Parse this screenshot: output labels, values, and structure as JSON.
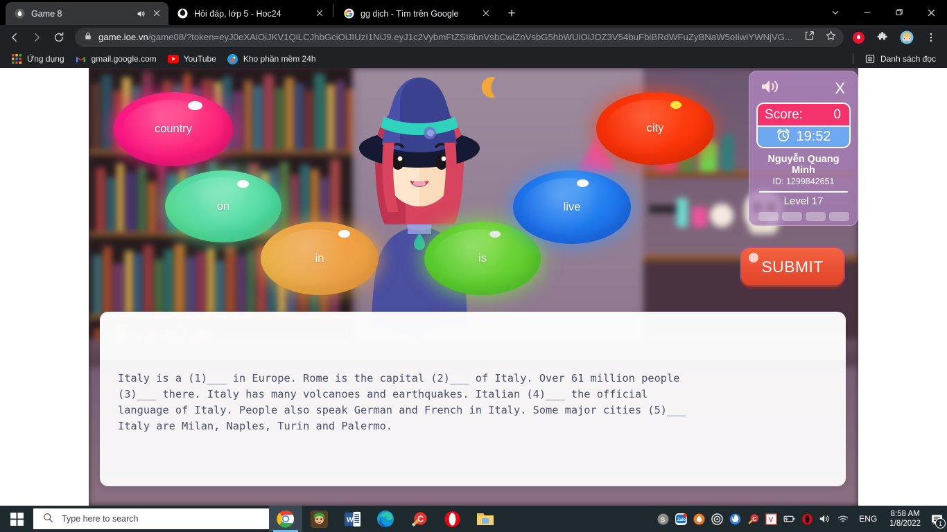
{
  "browser": {
    "tabs": [
      {
        "title": "Game 8",
        "favicon": "flame-icon",
        "active": true,
        "audio": true
      },
      {
        "title": "Hỏi đáp, lớp 5 - Hoc24",
        "favicon": "hoc24-icon",
        "active": false,
        "audio": false
      },
      {
        "title": "gg dịch - Tìm trên Google",
        "favicon": "google-icon",
        "active": false,
        "audio": false
      }
    ],
    "new_tab_label": "+",
    "window_controls": {
      "expand": "chevron-down-icon",
      "minimize": "minimize-icon",
      "maximize": "maximize-icon",
      "close": "close-icon"
    },
    "nav": {
      "back": "back-arrow-icon",
      "forward": "forward-arrow-icon",
      "reload": "reload-icon"
    },
    "omnibox": {
      "lock": "lock-icon",
      "host": "game.ioe.vn",
      "rest": "/game08/?token=eyJ0eXAiOiJKV1QiLCJhbGciOiJIUzI1NiJ9.eyJ1c2VybmFtZSI6bnVsbCwiZnVsbG5hbWUiOiJOZ3V54buFbiBRdWFuZyBNaW5oIiwiYWNjVG...",
      "share": "share-icon",
      "bookmark": "star-icon"
    },
    "toolbar_icons": [
      "shield-icon",
      "extensions-icon",
      "profile-avatar",
      "menu-dots-icon"
    ],
    "bookmarks": [
      {
        "label": "Ứng dụng",
        "icon": "apps-grid-icon"
      },
      {
        "label": "gmail.google.com",
        "icon": "gmail-icon"
      },
      {
        "label": "YouTube",
        "icon": "youtube-icon"
      },
      {
        "label": "Kho phần mềm 24h",
        "icon": "software-icon"
      }
    ],
    "reading_list": {
      "label": "Danh sách đọc",
      "icon": "reading-list-icon"
    }
  },
  "game": {
    "bubbles": [
      {
        "label": "country",
        "color": "#ff1f7a"
      },
      {
        "label": "on",
        "color": "#4fd9a0"
      },
      {
        "label": "in",
        "color": "#eda348"
      },
      {
        "label": "is",
        "color": "#62cf31"
      },
      {
        "label": "live",
        "color": "#1f7aee"
      },
      {
        "label": "city",
        "color": "#fb3408"
      }
    ],
    "submit_label": "SUBMIT",
    "hud": {
      "sound_icon": "speaker-icon",
      "close_label": "X",
      "score_label": "Score:",
      "score_value": "0",
      "timer_icon": "alarm-clock-icon",
      "timer_value": "19:52",
      "user_name": "Nguyễn Quang Minh",
      "user_id": "ID: 1299842651",
      "level": "Level 17",
      "progress_pips": 4
    },
    "passage": "Italy is a (1)___ in Europe. Rome is the capital (2)___ of Italy. Over 61 million people\n(3)___ there. Italy has many volcanoes and earthquakes. Italian (4)___ the official\nlanguage of Italy. People also speak German and French in Italy. Some major cities (5)___\nItaly are Milan, Naples, Turin and Palermo."
  },
  "taskbar": {
    "start_icon": "windows-start-icon",
    "search_placeholder": "Type here to search",
    "search_icon": "search-icon",
    "apps": [
      "chrome-icon",
      "game-icon",
      "word-icon",
      "edge-icon",
      "ccleaner-icon",
      "opera-icon",
      "file-explorer-icon"
    ],
    "tray_icons": [
      "skype-icon",
      "zalo-icon",
      "unikey-icon",
      "target-icon",
      "firefox-icon",
      "ccleaner-tray-icon",
      "v-icon",
      "battery-icon",
      "opera-tray-icon",
      "volume-icon",
      "wifi-icon"
    ],
    "language": "ENG",
    "time": "8:58 AM",
    "date": "1/8/2022",
    "notification_icon": "notification-icon",
    "notification_count": "1"
  }
}
